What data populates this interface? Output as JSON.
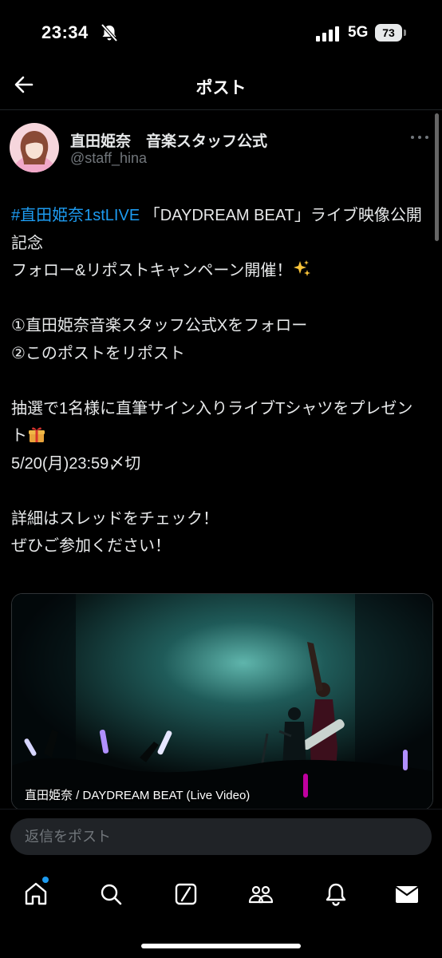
{
  "status": {
    "time": "23:34",
    "network": "5G",
    "battery": "73",
    "icons": [
      "bell-slash-icon",
      "signal-bars-icon",
      "battery-icon"
    ]
  },
  "header": {
    "title": "ポスト",
    "back_icon": "arrow-left-icon"
  },
  "post": {
    "author": {
      "name": "直田姫奈　音楽スタッフ公式",
      "handle": "@staff_hina"
    },
    "hashtag": "#直田姫奈1stLIVE",
    "line1_rest": " 「DAYDREAM BEAT」ライブ映像公開記念",
    "line2": "フォロー&リポストキャンペーン開催！",
    "line3": "①直田姫奈音楽スタッフ公式Xをフォロー",
    "line4": "②このポストをリポスト",
    "line5": "抽選で1名様に直筆サイン入りライブTシャツをプレゼント",
    "line6": "5/20(月)23:59〆切",
    "line7": "詳細はスレッドをチェック！",
    "line8": "ぜひご参加ください！",
    "emoji_sparkles": "sparkles-emoji",
    "emoji_gift": "gift-emoji",
    "media": {
      "caption": "直田姫奈 / DAYDREAM BEAT (Live Video)"
    }
  },
  "reply": {
    "placeholder": "返信をポスト"
  },
  "tabs": [
    {
      "icon": "home-icon",
      "has_dot": true
    },
    {
      "icon": "search-icon"
    },
    {
      "icon": "grok-icon"
    },
    {
      "icon": "communities-icon"
    },
    {
      "icon": "bell-icon"
    },
    {
      "icon": "mail-icon"
    }
  ],
  "colors": {
    "accent": "#1d9bf0",
    "background": "#000000",
    "text": "#e7e9ea",
    "muted": "#71767b"
  }
}
